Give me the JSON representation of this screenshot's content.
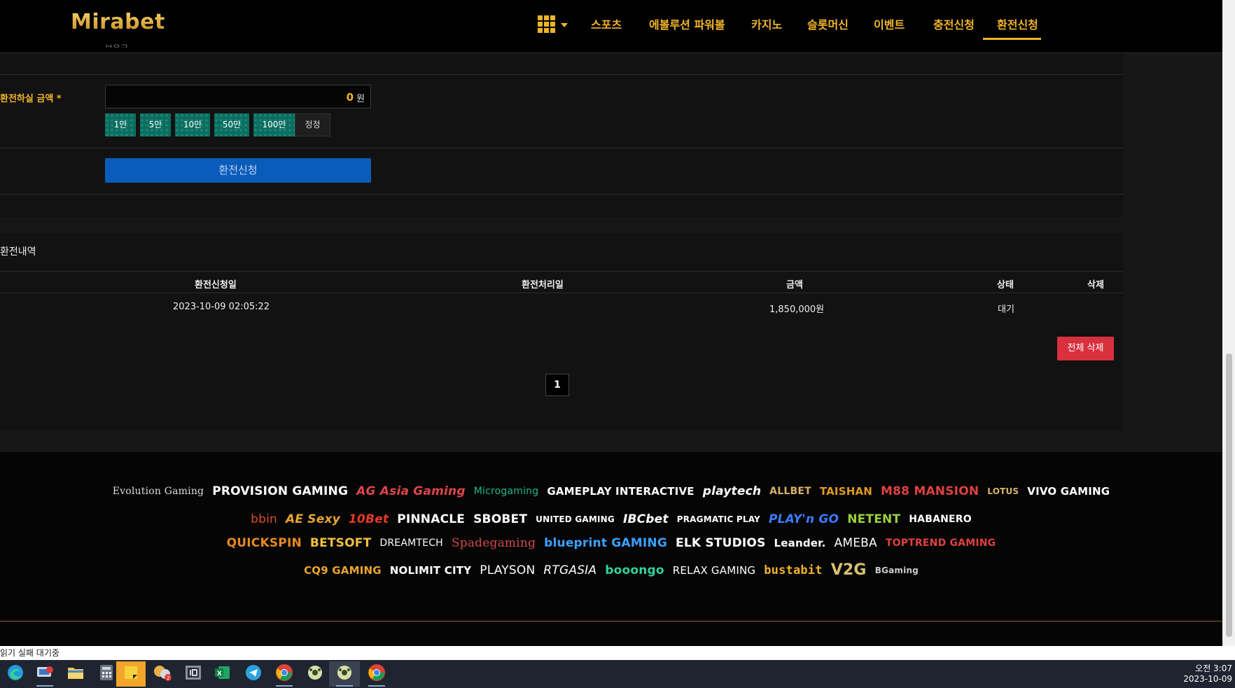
{
  "header": {
    "logo": "Mirabet",
    "nav": [
      "스포츠",
      "에볼루션 파워볼",
      "카지노",
      "슬롯머신",
      "이벤트",
      "충전신청",
      "환전신청"
    ],
    "active_nav": "환전신청"
  },
  "form": {
    "cut_label": "보유금",
    "amount_label": "환전하실 금액 *",
    "amount_value": "0",
    "amount_unit": "원",
    "chips": [
      "1만",
      "5만",
      "10만",
      "50만",
      "100만"
    ],
    "reset_label": "정정",
    "submit_label": "환전신청"
  },
  "history": {
    "title": "환전내역",
    "columns": [
      "환전신청일",
      "환전처리일",
      "금액",
      "상태",
      "삭제"
    ],
    "rows": [
      {
        "requested": "2023-10-09 02:05:22",
        "processed": "",
        "amount": "1,850,000원",
        "status": "대기",
        "delete": ""
      }
    ],
    "delete_all_label": "전체 삭제",
    "pages": [
      "1"
    ],
    "current_page": "1"
  },
  "footer": {
    "logo_rows": [
      [
        "Evolution Gaming",
        "PROVISION GAMING",
        "AG Asia Gaming",
        "Microgaming",
        "GAMEPLAY INTERACTIVE",
        "playtech",
        "ALLBET",
        "TAISHAN",
        "M88 MANSION",
        "LOTUS",
        "VIVO GAMING"
      ],
      [
        "bbin",
        "AE Sexy",
        "10Bet",
        "PINNACLE",
        "SBOBET",
        "UNITED GAMING",
        "IBCbet",
        "PRAGMATIC PLAY",
        "PLAY'n GO",
        "NETENT",
        "HABANERO"
      ],
      [
        "QUICKSPIN",
        "BETSOFT",
        "DREAMTECH",
        "Spadegaming",
        "blueprint GAMING",
        "ELK STUDIOS",
        "Leander.",
        "AMEBA",
        "TOPTREND GAMING"
      ],
      [
        "CQ9 GAMING",
        "NOLIMIT CITY",
        "PLAYSON",
        "RTGASIA",
        "booongo",
        "RELAX GAMING",
        "bustabit",
        "V2G",
        "BGaming"
      ]
    ]
  },
  "statusbar": {
    "text": "읽기 실패  대기중"
  },
  "taskbar": {
    "apps": [
      "edge",
      "remote-desktop",
      "file-explorer",
      "calculator",
      "sticky-notes",
      "chat",
      "id-app",
      "excel",
      "telegram",
      "chrome",
      "game-app",
      "game-app-2",
      "chrome-2"
    ],
    "badge": "2",
    "time": "오전 3:07",
    "date": "2023-10-09"
  },
  "colors": {
    "accent": "#f0b429",
    "submit": "#0a5cba",
    "danger": "#d9303e",
    "chip": "#0d6d5e"
  }
}
